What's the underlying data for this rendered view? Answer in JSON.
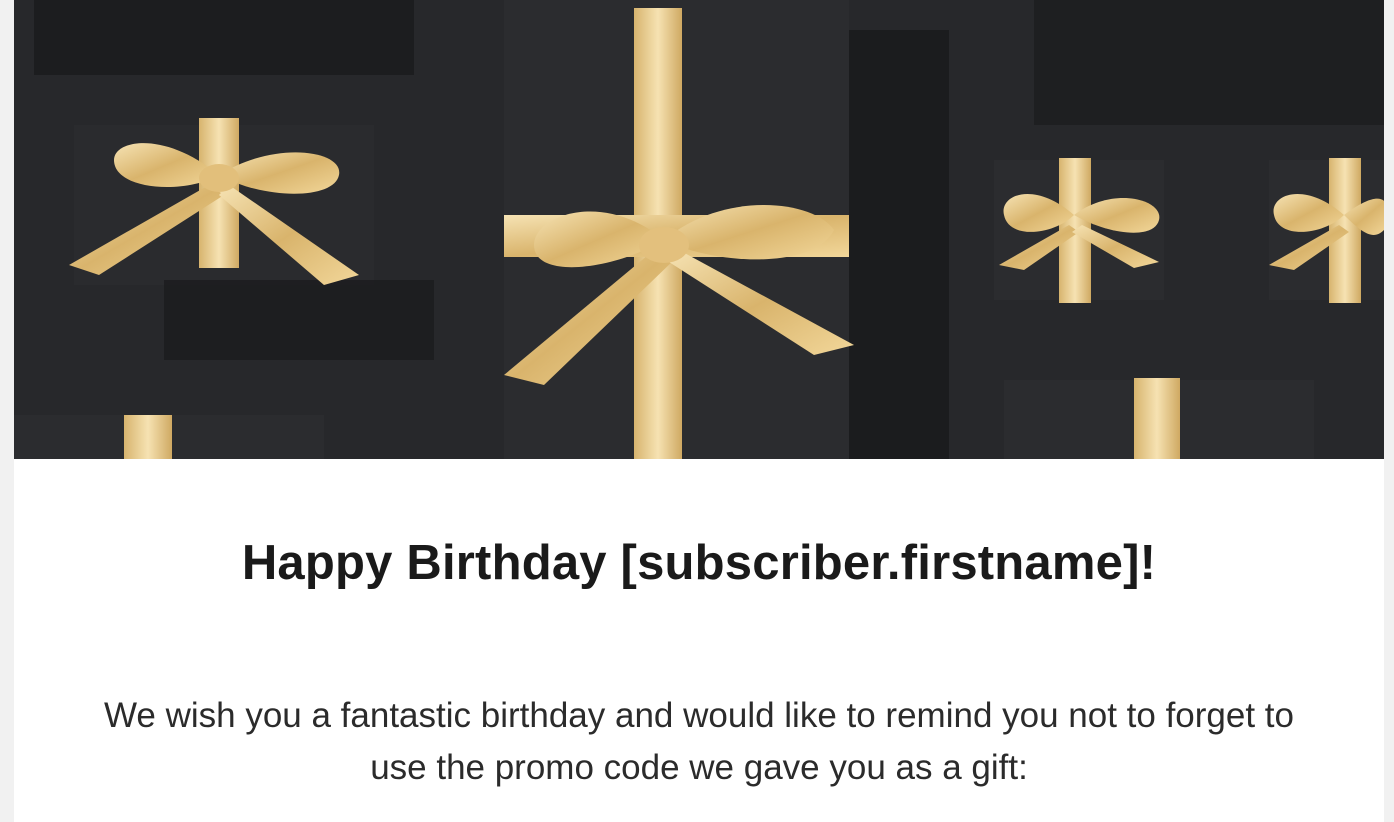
{
  "email": {
    "hero_image_icon": "gift-boxes-gold-ribbon",
    "headline": "Happy Birthday [subscriber.firstname]!",
    "message_line1": "We wish you a fantastic birthday and would like to remind you not to forget to",
    "message_line2": "use the promo code we gave you as a gift:"
  },
  "colors": {
    "hero_background": "#27282b",
    "ribbon_gold": "#e8c98a",
    "text": "#1a1a1a"
  }
}
